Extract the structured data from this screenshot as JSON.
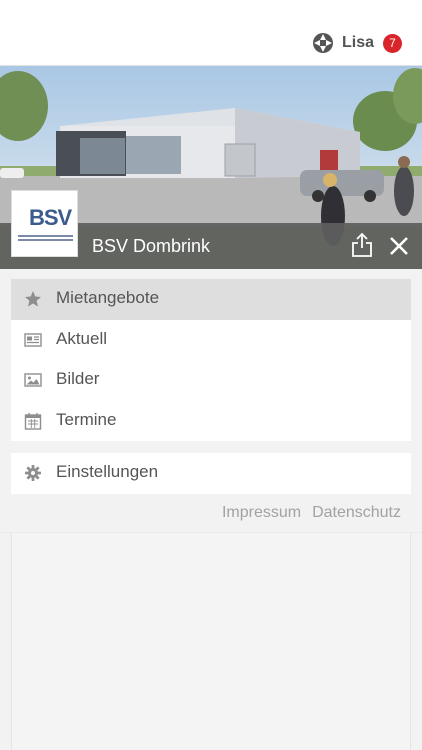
{
  "header": {
    "user_name": "Lisa",
    "notification_count": "7"
  },
  "profile": {
    "logo_text": "BSV",
    "title": "BSV Dombrink"
  },
  "menu": {
    "items": [
      {
        "label": "Mietangebote",
        "icon": "star-icon",
        "active": true
      },
      {
        "label": "Aktuell",
        "icon": "newspaper-icon",
        "active": false
      },
      {
        "label": "Bilder",
        "icon": "image-icon",
        "active": false
      },
      {
        "label": "Termine",
        "icon": "calendar-icon",
        "active": false
      }
    ],
    "settings_label": "Einstellungen"
  },
  "footer": {
    "impressum": "Impressum",
    "datenschutz": "Datenschutz"
  },
  "colors": {
    "badge": "#d9242c",
    "title_bar": "#5f5f5f",
    "active_item": "#dedede"
  }
}
